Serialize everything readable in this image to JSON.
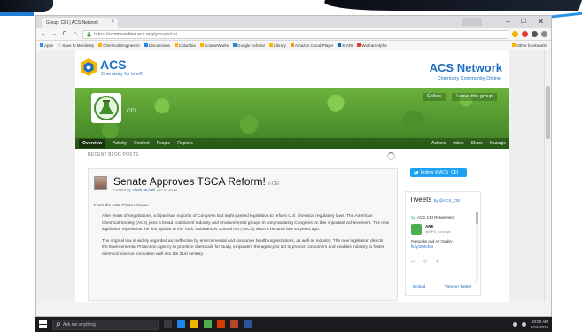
{
  "browser": {
    "tab_title": "Group: CEI | ACS Network",
    "tab_close": "×",
    "url_scheme": "https://",
    "url_host": "communities.acs.org",
    "url_path": "/groups/cei",
    "controls": {
      "minimize": "–",
      "maximize": "☐",
      "close": "✕"
    },
    "nav": {
      "back": "←",
      "forward": "→",
      "reload": "C",
      "home": "⌂"
    },
    "bookmarks": [
      "Apps",
      "Save to Mendeley",
      "Chemical Engineerin",
      "Discussions",
      "Columbia",
      "CourseWorks",
      "Google Scholar",
      "Library",
      "Amazon Cloud Player",
      "E-ARI",
      "WolframAlpha"
    ],
    "other_bookmarks": "Other bookmarks"
  },
  "site": {
    "brand": "ACS",
    "tagline": "Chemistry for Life®",
    "network_title": "ACS Network",
    "network_subtitle": "Chemistry Community Online",
    "group_tag": "CEI",
    "follow_btn": "Follow",
    "leave_btn": "Leave this group",
    "nav": [
      "Overview",
      "Activity",
      "Content",
      "People",
      "Reports"
    ],
    "nav_right": [
      "Actions",
      "Inbox",
      "Share",
      "Manage"
    ]
  },
  "content": {
    "section_label": "RECENT BLOG POSTS",
    "post": {
      "title": "Senate Approves TSCA Reform!",
      "in_group": "in CEI",
      "posted_by_prefix": "Posted by",
      "author": "Vivek McNeil",
      "date": "Jun 8, 2016",
      "paragraphs": [
        "From the ACS Press release:",
        "After years of negotiations, a bipartisan majority of Congress last night passed legislation to reform U.S. chemical regulatory laws. The American Chemical Society (ACS) joins a broad coalition of industry and environmental groups in congratulating Congress on this important achievement. The new legislation represents the first update to the Toxic Substances Control Act (TSCA) since it became law 40 years ago.",
        "The original law is widely regarded as ineffective by environmental and consumer health organizations, as well as industry. The new legislation directs the Environmental Protection Agency to prioritize chemicals for study, empowers the agency to act to protect consumers and enables industry to foster chemical science innovation well into the 21st century."
      ]
    }
  },
  "twitter": {
    "follow_button": "Follow @ACS_CEI",
    "header": "Tweets",
    "header_by": "by @ACS_CEI",
    "retweet_label": "ACS CEI Retweeted",
    "name": "ARE",
    "handle": "@APS_concept",
    "text": "Fireworks and Air Quality",
    "link": "fb.ly/2IHkdV4",
    "embed": "Embed",
    "view": "View on Twitter"
  },
  "taskbar": {
    "search_placeholder": "Ask me anything",
    "time": "10:50 AM",
    "date": "6/16/2016"
  }
}
